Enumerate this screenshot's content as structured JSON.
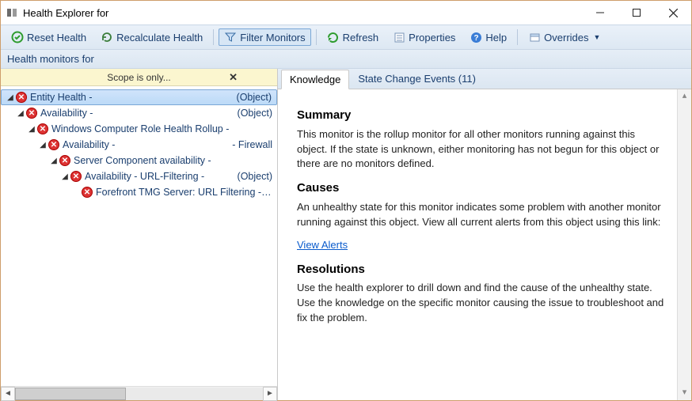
{
  "window": {
    "title": "Health Explorer for",
    "minimize": "window-minimize",
    "maximize": "window-maximize",
    "close": "window-close"
  },
  "toolbar": {
    "reset": "Reset Health",
    "recalc": "Recalculate Health",
    "filter": "Filter Monitors",
    "refresh": "Refresh",
    "properties": "Properties",
    "help": "Help",
    "overrides": "Overrides"
  },
  "subheader": "Health monitors for",
  "scope": {
    "label": "Scope is only...",
    "close": "✕"
  },
  "tree": [
    {
      "indent": 0,
      "expanded": true,
      "label": "Entity Health -",
      "trail": "(Object)",
      "selected": true,
      "name": "entity-health"
    },
    {
      "indent": 1,
      "expanded": true,
      "label": "Availability -",
      "trail": "(Object)",
      "name": "availability-object"
    },
    {
      "indent": 2,
      "expanded": true,
      "label": "Windows Computer Role Health Rollup -",
      "trail": "",
      "name": "windows-computer-role-health-rollup"
    },
    {
      "indent": 3,
      "expanded": true,
      "label": "Availability -",
      "trail": "- Firewall",
      "name": "availability-firewall"
    },
    {
      "indent": 4,
      "expanded": true,
      "label": "Server Component availability -",
      "trail": "",
      "name": "server-component-availability"
    },
    {
      "indent": 5,
      "expanded": true,
      "label": "Availability - URL-Filtering -",
      "trail": "(Object)",
      "name": "availability-url-filtering"
    },
    {
      "indent": 6,
      "expanded": false,
      "leaf": true,
      "label": "Forefront TMG Server: URL Filtering - Server",
      "trail": "",
      "name": "forefront-tmg-url-filtering"
    }
  ],
  "tabs": {
    "knowledge": "Knowledge",
    "state_change": "State Change Events (11)"
  },
  "knowledge": {
    "summary_h": "Summary",
    "summary_p": "This monitor is the rollup monitor for all other monitors running against this object. If the state is unknown, either monitoring has not begun for this object or there are no monitors defined.",
    "causes_h": "Causes",
    "causes_p": "An unhealthy state for this monitor indicates some problem with another monitor running against this object. View all current alerts from this object using this link:",
    "view_alerts": "View Alerts",
    "resolutions_h": "Resolutions",
    "resolutions_p": "Use the health explorer to drill down and find the cause of the unhealthy state. Use the knowledge on the specific monitor causing the issue to troubleshoot and fix the problem."
  }
}
